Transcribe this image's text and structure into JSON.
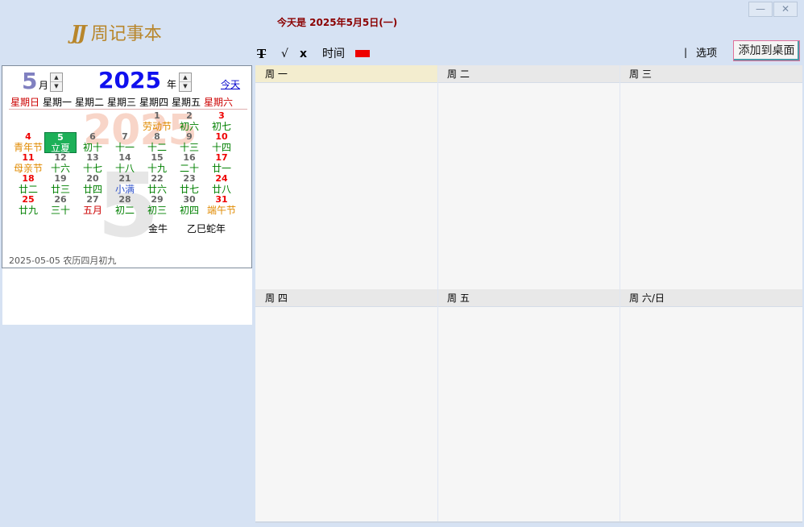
{
  "app": {
    "logo_mark": "JJ",
    "logo_text": "周记事本",
    "today_line": "今天是 2025年5月5日(一)",
    "window": {
      "minimize": "—",
      "close": "✕"
    }
  },
  "toolbar": {
    "bold_label": "T",
    "check_label": "√",
    "delete_label": "x",
    "time_label": "时间",
    "color_swatch": "#ee0000",
    "separator": "|",
    "options_label": "选项",
    "add_desktop_label": "添加到桌面"
  },
  "calendar": {
    "month": "5",
    "month_unit": "月",
    "year": "2025",
    "year_unit": "年",
    "today_link": "今天",
    "watermark_year": "2025",
    "watermark_month": "5",
    "weekdays": [
      "星期日",
      "星期一",
      "星期二",
      "星期三",
      "星期四",
      "星期五",
      "星期六"
    ],
    "weekday_colors": [
      "#cc0000",
      "#000000",
      "#000000",
      "#000000",
      "#000000",
      "#000000",
      "#cc0000"
    ],
    "days": [
      {
        "num": "1",
        "lunar": "劳动节",
        "col": 4,
        "row": 0,
        "num_color": "#666666",
        "lunar_color": "#e08a00"
      },
      {
        "num": "2",
        "lunar": "初六",
        "col": 5,
        "row": 0,
        "num_color": "#666666",
        "lunar_color": "#008000"
      },
      {
        "num": "3",
        "lunar": "初七",
        "col": 6,
        "row": 0,
        "num_color": "#ee0000",
        "lunar_color": "#008000"
      },
      {
        "num": "4",
        "lunar": "青年节",
        "col": 0,
        "row": 1,
        "num_color": "#ee0000",
        "lunar_color": "#e08a00"
      },
      {
        "num": "5",
        "lunar": "立夏",
        "col": 1,
        "row": 1,
        "num_color": "#666666",
        "lunar_color": "#008000",
        "selected": true
      },
      {
        "num": "6",
        "lunar": "初十",
        "col": 2,
        "row": 1,
        "num_color": "#666666",
        "lunar_color": "#008000"
      },
      {
        "num": "7",
        "lunar": "十一",
        "col": 3,
        "row": 1,
        "num_color": "#666666",
        "lunar_color": "#008000"
      },
      {
        "num": "8",
        "lunar": "十二",
        "col": 4,
        "row": 1,
        "num_color": "#666666",
        "lunar_color": "#008000"
      },
      {
        "num": "9",
        "lunar": "十三",
        "col": 5,
        "row": 1,
        "num_color": "#666666",
        "lunar_color": "#008000"
      },
      {
        "num": "10",
        "lunar": "十四",
        "col": 6,
        "row": 1,
        "num_color": "#ee0000",
        "lunar_color": "#008000"
      },
      {
        "num": "11",
        "lunar": "母亲节",
        "col": 0,
        "row": 2,
        "num_color": "#ee0000",
        "lunar_color": "#e08a00"
      },
      {
        "num": "12",
        "lunar": "十六",
        "col": 1,
        "row": 2,
        "num_color": "#666666",
        "lunar_color": "#008000"
      },
      {
        "num": "13",
        "lunar": "十七",
        "col": 2,
        "row": 2,
        "num_color": "#666666",
        "lunar_color": "#008000"
      },
      {
        "num": "14",
        "lunar": "十八",
        "col": 3,
        "row": 2,
        "num_color": "#666666",
        "lunar_color": "#008000"
      },
      {
        "num": "15",
        "lunar": "十九",
        "col": 4,
        "row": 2,
        "num_color": "#666666",
        "lunar_color": "#008000"
      },
      {
        "num": "16",
        "lunar": "二十",
        "col": 5,
        "row": 2,
        "num_color": "#666666",
        "lunar_color": "#008000"
      },
      {
        "num": "17",
        "lunar": "廿一",
        "col": 6,
        "row": 2,
        "num_color": "#ee0000",
        "lunar_color": "#008000"
      },
      {
        "num": "18",
        "lunar": "廿二",
        "col": 0,
        "row": 3,
        "num_color": "#ee0000",
        "lunar_color": "#008000"
      },
      {
        "num": "19",
        "lunar": "廿三",
        "col": 1,
        "row": 3,
        "num_color": "#666666",
        "lunar_color": "#008000"
      },
      {
        "num": "20",
        "lunar": "廿四",
        "col": 2,
        "row": 3,
        "num_color": "#666666",
        "lunar_color": "#008000"
      },
      {
        "num": "21",
        "lunar": "小满",
        "col": 3,
        "row": 3,
        "num_color": "#666666",
        "lunar_color": "#3355cc"
      },
      {
        "num": "22",
        "lunar": "廿六",
        "col": 4,
        "row": 3,
        "num_color": "#666666",
        "lunar_color": "#008000"
      },
      {
        "num": "23",
        "lunar": "廿七",
        "col": 5,
        "row": 3,
        "num_color": "#666666",
        "lunar_color": "#008000"
      },
      {
        "num": "24",
        "lunar": "廿八",
        "col": 6,
        "row": 3,
        "num_color": "#ee0000",
        "lunar_color": "#008000"
      },
      {
        "num": "25",
        "lunar": "廿九",
        "col": 0,
        "row": 4,
        "num_color": "#ee0000",
        "lunar_color": "#008000"
      },
      {
        "num": "26",
        "lunar": "三十",
        "col": 1,
        "row": 4,
        "num_color": "#666666",
        "lunar_color": "#008000"
      },
      {
        "num": "27",
        "lunar": "五月",
        "col": 2,
        "row": 4,
        "num_color": "#666666",
        "lunar_color": "#cc0000"
      },
      {
        "num": "28",
        "lunar": "初二",
        "col": 3,
        "row": 4,
        "num_color": "#666666",
        "lunar_color": "#008000"
      },
      {
        "num": "29",
        "lunar": "初三",
        "col": 4,
        "row": 4,
        "num_color": "#666666",
        "lunar_color": "#008000"
      },
      {
        "num": "30",
        "lunar": "初四",
        "col": 5,
        "row": 4,
        "num_color": "#666666",
        "lunar_color": "#008000"
      },
      {
        "num": "31",
        "lunar": "端午节",
        "col": 6,
        "row": 4,
        "num_color": "#ee0000",
        "lunar_color": "#e08a00"
      }
    ],
    "zodiac": "金牛",
    "ganzhi": "乙巳蛇年",
    "footer": "2025-05-05  农历四月初九"
  },
  "week": {
    "days": [
      {
        "label": "周 一",
        "current": true
      },
      {
        "label": "周 二",
        "current": false
      },
      {
        "label": "周 三",
        "current": false
      },
      {
        "label": "周 四",
        "current": false
      },
      {
        "label": "周 五",
        "current": false
      },
      {
        "label": "周 六/日",
        "current": false
      }
    ]
  }
}
